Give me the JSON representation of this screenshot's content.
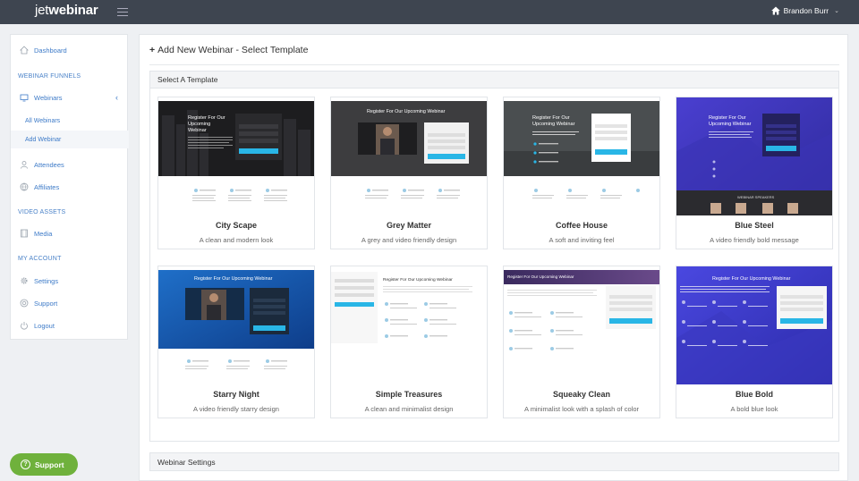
{
  "header": {
    "logo_light": "jet",
    "logo_bold": "webinar",
    "user_name": "Brandon Burr"
  },
  "sidebar": {
    "dashboard": "Dashboard",
    "section_funnels": "WEBINAR FUNNELS",
    "webinars": "Webinars",
    "all_webinars": "All Webinars",
    "add_webinar": "Add Webinar",
    "attendees": "Attendees",
    "affiliates": "Affiliates",
    "section_video": "VIDEO ASSETS",
    "media": "Media",
    "section_account": "MY ACCOUNT",
    "settings": "Settings",
    "support": "Support",
    "logout": "Logout"
  },
  "main": {
    "title": "Add New Webinar - Select Template",
    "template_panel_title": "Select A Template",
    "settings_panel_title": "Webinar Settings",
    "templates": [
      {
        "name": "City Scape",
        "desc": "A clean and modern look",
        "headline": "Register For Our Upcoming Webinar"
      },
      {
        "name": "Grey Matter",
        "desc": "A grey and video friendly design",
        "headline": "Register For Our Upcoming Webinar"
      },
      {
        "name": "Coffee House",
        "desc": "A soft and inviting feel",
        "headline": "Register For Our Upcoming Webinar"
      },
      {
        "name": "Blue Steel",
        "desc": "A video friendly bold message",
        "headline": "Register For Our Upcoming Webinar",
        "footer": "WEBINAR SPEAKERS"
      },
      {
        "name": "Starry Night",
        "desc": "A video friendly starry design",
        "headline": "Register For Our Upcoming Webinar"
      },
      {
        "name": "Simple Treasures",
        "desc": "A clean and minimalist design",
        "headline": "Register For Our Upcoming Webinar"
      },
      {
        "name": "Squeaky Clean",
        "desc": "A minimalist look with a splash of color",
        "headline": "Register For Our Upcoming Webinar"
      },
      {
        "name": "Blue Bold",
        "desc": "A bold blue look",
        "headline": "Register For Our Upcoming Webinar"
      }
    ]
  },
  "support_button": "Support",
  "colors": {
    "topbar": "#3e4550",
    "link": "#3e7bc8",
    "accent_cyan": "#29b6e6",
    "support_green": "#6fb13c"
  }
}
